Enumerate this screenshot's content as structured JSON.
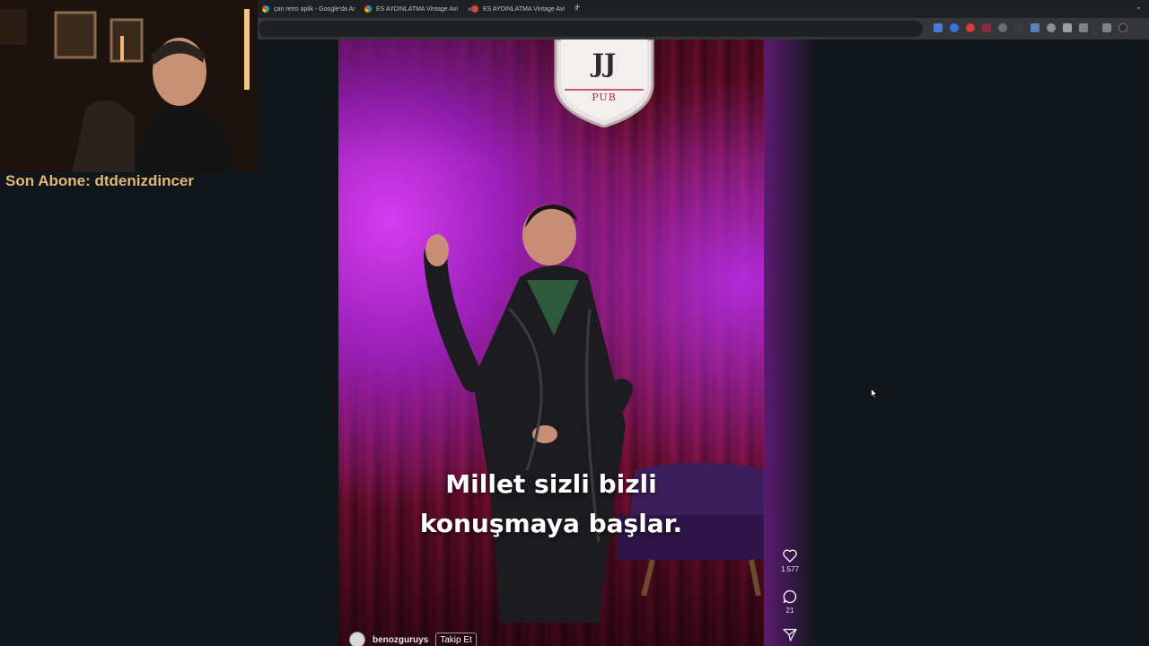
{
  "browser": {
    "tabs": [
      {
        "title": "çan retro aplik - Google'da Ar",
        "favicon": "google-favicon"
      },
      {
        "title": "ES AYDINLATMA Vintage Avi",
        "favicon": "google-favicon"
      },
      {
        "title": "ES AYDINLATMA Vintage Avi",
        "favicon": "site-favicon"
      }
    ],
    "close_glyph": "×",
    "new_tab_glyph": "+",
    "tab_menu_glyph": "⌄"
  },
  "stream": {
    "last_subscriber": "Son Abone: dtdenizdincer"
  },
  "video": {
    "crest_text": "JJ",
    "crest_sub": "PUB",
    "subtitle_line1": "Millet sizli bizli",
    "subtitle_line2": "konuşmaya başlar.",
    "author_name": "benozguruys",
    "follow_label": "Takip Et"
  },
  "actions": {
    "likes": "1.577",
    "comments": "21"
  },
  "colors": {
    "accent_name": "#e3b874",
    "curtain": "#6b0f2c",
    "stage_light": "#d63df0"
  }
}
